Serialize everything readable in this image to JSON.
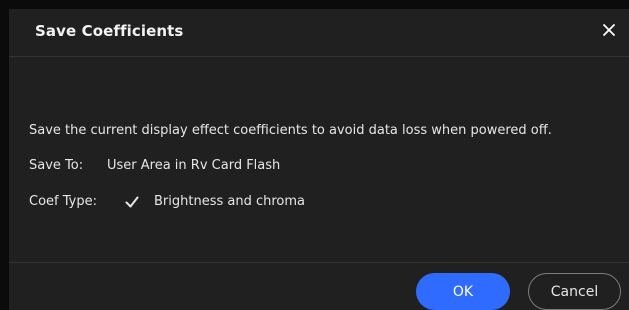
{
  "dialog": {
    "title": "Save Coefficients",
    "close_icon": "close-icon",
    "description": "Save the current display effect coefficients to avoid data loss when powered off.",
    "save_to": {
      "label": "Save To:",
      "value": "User Area in Rv Card Flash"
    },
    "coef_type": {
      "label": "Coef Type:",
      "checked": true,
      "option_label": "Brightness and chroma"
    },
    "buttons": {
      "ok_label": "OK",
      "cancel_label": "Cancel"
    }
  },
  "colors": {
    "background": "#0b0b0b",
    "dialog_bg": "#202020",
    "accent": "#2f6bff",
    "text": "#e6e6e6",
    "divider": "#333333"
  }
}
